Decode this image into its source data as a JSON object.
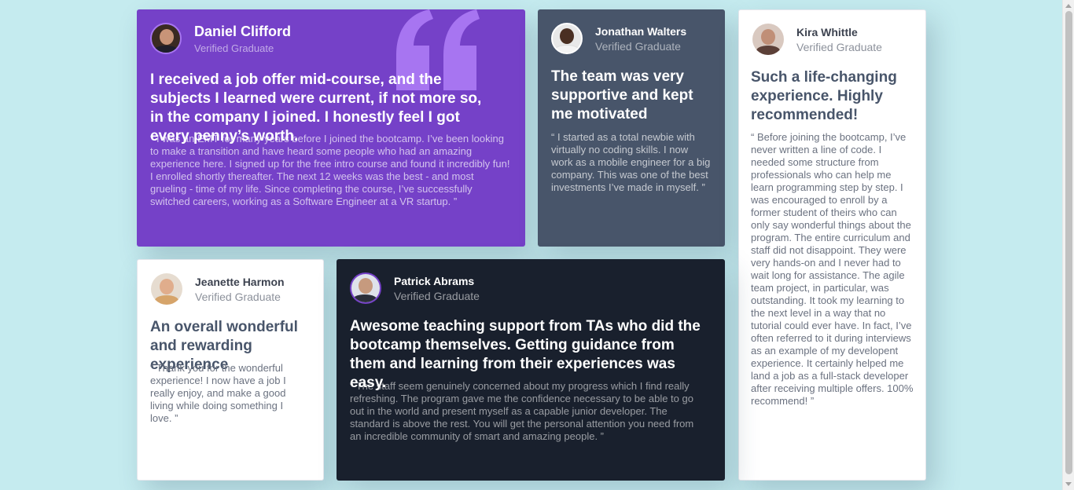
{
  "colors": {
    "background": "#c5ebef",
    "purple": "#7541c8",
    "slate": "#48556a",
    "white": "#ffffff",
    "dark": "#19202d"
  },
  "testimonials": [
    {
      "name": "Daniel Clifford",
      "role": "Verified Graduate",
      "headline": "I received a job offer mid-course, and the subjects I learned were current, if not more so, in the company I joined. I honestly feel I got every penny’s worth.",
      "body": "“ I was an EMT for many years before I joined the bootcamp. I’ve been looking to make a transition and have heard some people who had an amazing experience here. I signed up for the free intro course and found it incredibly fun! I enrolled shortly thereafter. The next 12 weeks was the best - and most grueling - time of my life. Since completing the course, I’ve successfully switched careers, working as a Software Engineer at a VR startup. ”"
    },
    {
      "name": "Jonathan Walters",
      "role": "Verified Graduate",
      "headline": "The team was very supportive and kept me motivated",
      "body": "“ I started as a total newbie with virtually no coding skills. I now work as a mobile engineer for a big company. This was one of the best investments I’ve made in myself. ”"
    },
    {
      "name": "Kira Whittle",
      "role": "Verified Graduate",
      "headline": "Such a life-changing experience. Highly recommended!",
      "body": "“ Before joining the bootcamp, I’ve never written a line of code. I needed some structure from professionals who can help me learn programming step by step. I was encouraged to enroll by a former student of theirs who can only say wonderful things about the program. The entire curriculum and staff did not disappoint. They were very hands-on and I never had to wait long for assistance. The agile team project, in particular, was outstanding. It took my learning to the next level in a way that no tutorial could ever have. In fact, I’ve often referred to it during interviews as an example of my developent experience. It certainly helped me land a job as a full-stack developer after receiving multiple offers. 100% recommend! ”"
    },
    {
      "name": "Jeanette Harmon",
      "role": "Verified Graduate",
      "headline": "An overall wonderful and rewarding experience",
      "body": "“ Thank you for the wonderful experience! I now have a job I really enjoy, and make a good living while doing something I love. ”"
    },
    {
      "name": "Patrick Abrams",
      "role": "Verified Graduate",
      "headline": "Awesome teaching support from TAs who did the bootcamp themselves. Getting guidance from them and learning from their experiences was easy.",
      "body": "“ The staff seem genuinely concerned about my progress which I find really refreshing. The program gave me the confidence necessary to be able to go out in the world and present myself as a capable junior developer. The standard is above the rest. You will get the personal attention you need from an incredible community of smart and amazing people. ”"
    }
  ]
}
